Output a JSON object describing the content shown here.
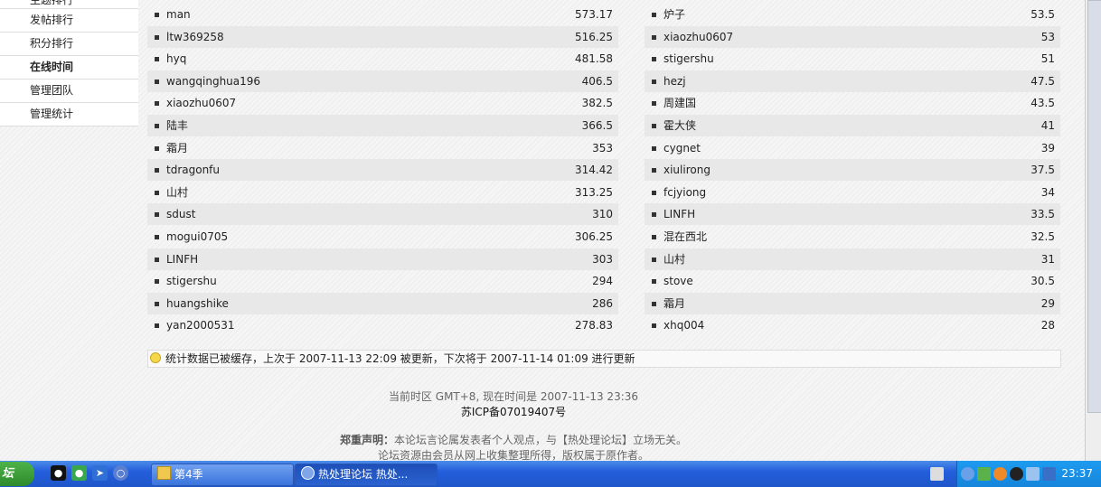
{
  "sidebar": {
    "items": [
      {
        "label": "主题排行",
        "active": false
      },
      {
        "label": "发帖排行",
        "active": false
      },
      {
        "label": "积分排行",
        "active": false
      },
      {
        "label": "在线时间",
        "active": true
      },
      {
        "label": "管理团队",
        "active": false
      },
      {
        "label": "管理统计",
        "active": false
      }
    ]
  },
  "rankings": {
    "left": [
      {
        "name": "man",
        "value": "573.17"
      },
      {
        "name": "ltw369258",
        "value": "516.25"
      },
      {
        "name": "hyq",
        "value": "481.58"
      },
      {
        "name": "wangqinghua196",
        "value": "406.5"
      },
      {
        "name": "xiaozhu0607",
        "value": "382.5"
      },
      {
        "name": "陆丰",
        "value": "366.5"
      },
      {
        "name": "霜月",
        "value": "353"
      },
      {
        "name": "tdragonfu",
        "value": "314.42"
      },
      {
        "name": "山村",
        "value": "313.25"
      },
      {
        "name": "sdust",
        "value": "310"
      },
      {
        "name": "mogui0705",
        "value": "306.25"
      },
      {
        "name": "LINFH",
        "value": "303"
      },
      {
        "name": "stigershu",
        "value": "294"
      },
      {
        "name": "huangshike",
        "value": "286"
      },
      {
        "name": "yan2000531",
        "value": "278.83"
      }
    ],
    "right": [
      {
        "name": "炉子",
        "value": "53.5"
      },
      {
        "name": "xiaozhu0607",
        "value": "53"
      },
      {
        "name": "stigershu",
        "value": "51"
      },
      {
        "name": "hezj",
        "value": "47.5"
      },
      {
        "name": "周建国",
        "value": "43.5"
      },
      {
        "name": "霍大侠",
        "value": "41"
      },
      {
        "name": "cygnet",
        "value": "39"
      },
      {
        "name": "xiulirong",
        "value": "37.5"
      },
      {
        "name": "fcjyiong",
        "value": "34"
      },
      {
        "name": "LINFH",
        "value": "33.5"
      },
      {
        "name": "混在西北",
        "value": "32.5"
      },
      {
        "name": "山村",
        "value": "31"
      },
      {
        "name": "stove",
        "value": "30.5"
      },
      {
        "name": "霜月",
        "value": "29"
      },
      {
        "name": "xhq004",
        "value": "28"
      }
    ]
  },
  "notice": {
    "text": "统计数据已被缓存，上次于 2007-11-13 22:09 被更新，下次将于 2007-11-14 01:09 进行更新",
    "icon": "lightbulb-icon"
  },
  "footer": {
    "timezone_line": "当前时区 GMT+8, 现在时间是 2007-11-13 23:36",
    "icp": "苏ICP备07019407号",
    "disclaimer_label": "郑重声明：",
    "disclaimer_text": "本论坛言论属发表者个人观点，与【热处理论坛】立场无关。",
    "disclaimer_line2": "论坛资源由会员从网上收集整理所得，版权属于原作者。",
    "forum_name": "热处理论坛"
  },
  "taskbar": {
    "start_label": "坛",
    "quicklaunch": [
      "qq-icon",
      "msn-icon",
      "send-icon",
      "browser-icon"
    ],
    "tasks": [
      {
        "label": "第4季",
        "icon": "folder-icon",
        "active": false
      },
      {
        "label": "热处理论坛 热处...",
        "icon": "browser-icon",
        "active": true
      }
    ],
    "tray_icons": [
      "keyboard-icon",
      "arrow-icon",
      "green-icon",
      "orange-icon",
      "qq-tray-icon",
      "network-icon",
      "shield-icon"
    ],
    "clock": "23:37"
  },
  "colors": {
    "taskbar": "#245edb",
    "start": "#3c9e38",
    "band": "#e8e8e8",
    "tray": "#1d9bf0"
  }
}
